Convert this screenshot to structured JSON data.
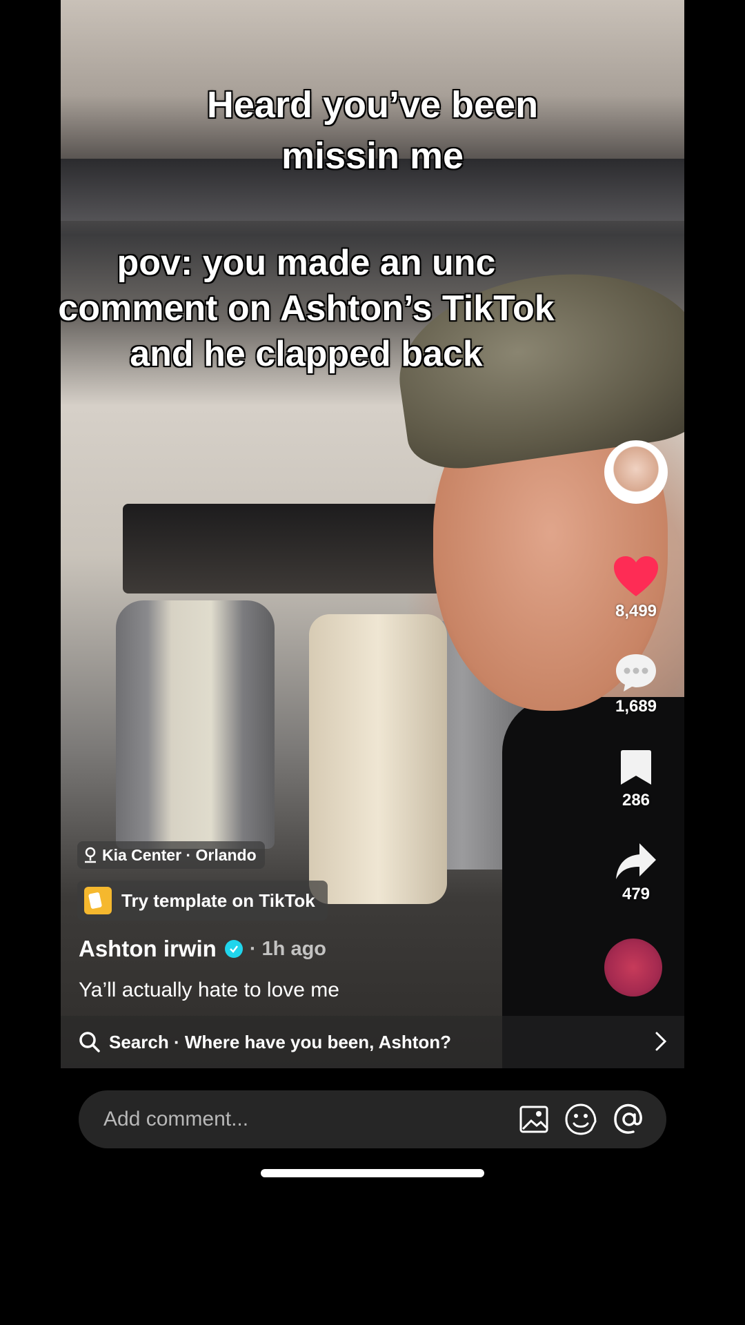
{
  "video": {
    "overlay_text_1": "Heard you’ve been missin me",
    "overlay_text_2_line1": "pov: you made an unc",
    "overlay_text_2_line2": "comment on Ashton’s TikTok",
    "overlay_text_2_line3": "and he clapped back"
  },
  "actions": {
    "likes": "8,499",
    "comments": "1,689",
    "saves": "286",
    "shares": "479",
    "like_color": "#fe2c55"
  },
  "post": {
    "location": "Kia Center · Orlando",
    "template_label": "Try template on TikTok",
    "author": "Ashton irwin",
    "time": "· 1h ago",
    "caption": "Ya’ll actually hate to love me"
  },
  "search": {
    "text": "Search · Where have you been, Ashton?"
  },
  "comment_bar": {
    "placeholder": "Add comment..."
  },
  "icons": [
    "location-pin-icon",
    "template-icon",
    "verified-icon",
    "heart-icon",
    "comment-icon",
    "bookmark-icon",
    "share-icon",
    "search-icon",
    "chevron-right-icon",
    "image-icon",
    "emoji-icon",
    "mention-icon"
  ]
}
